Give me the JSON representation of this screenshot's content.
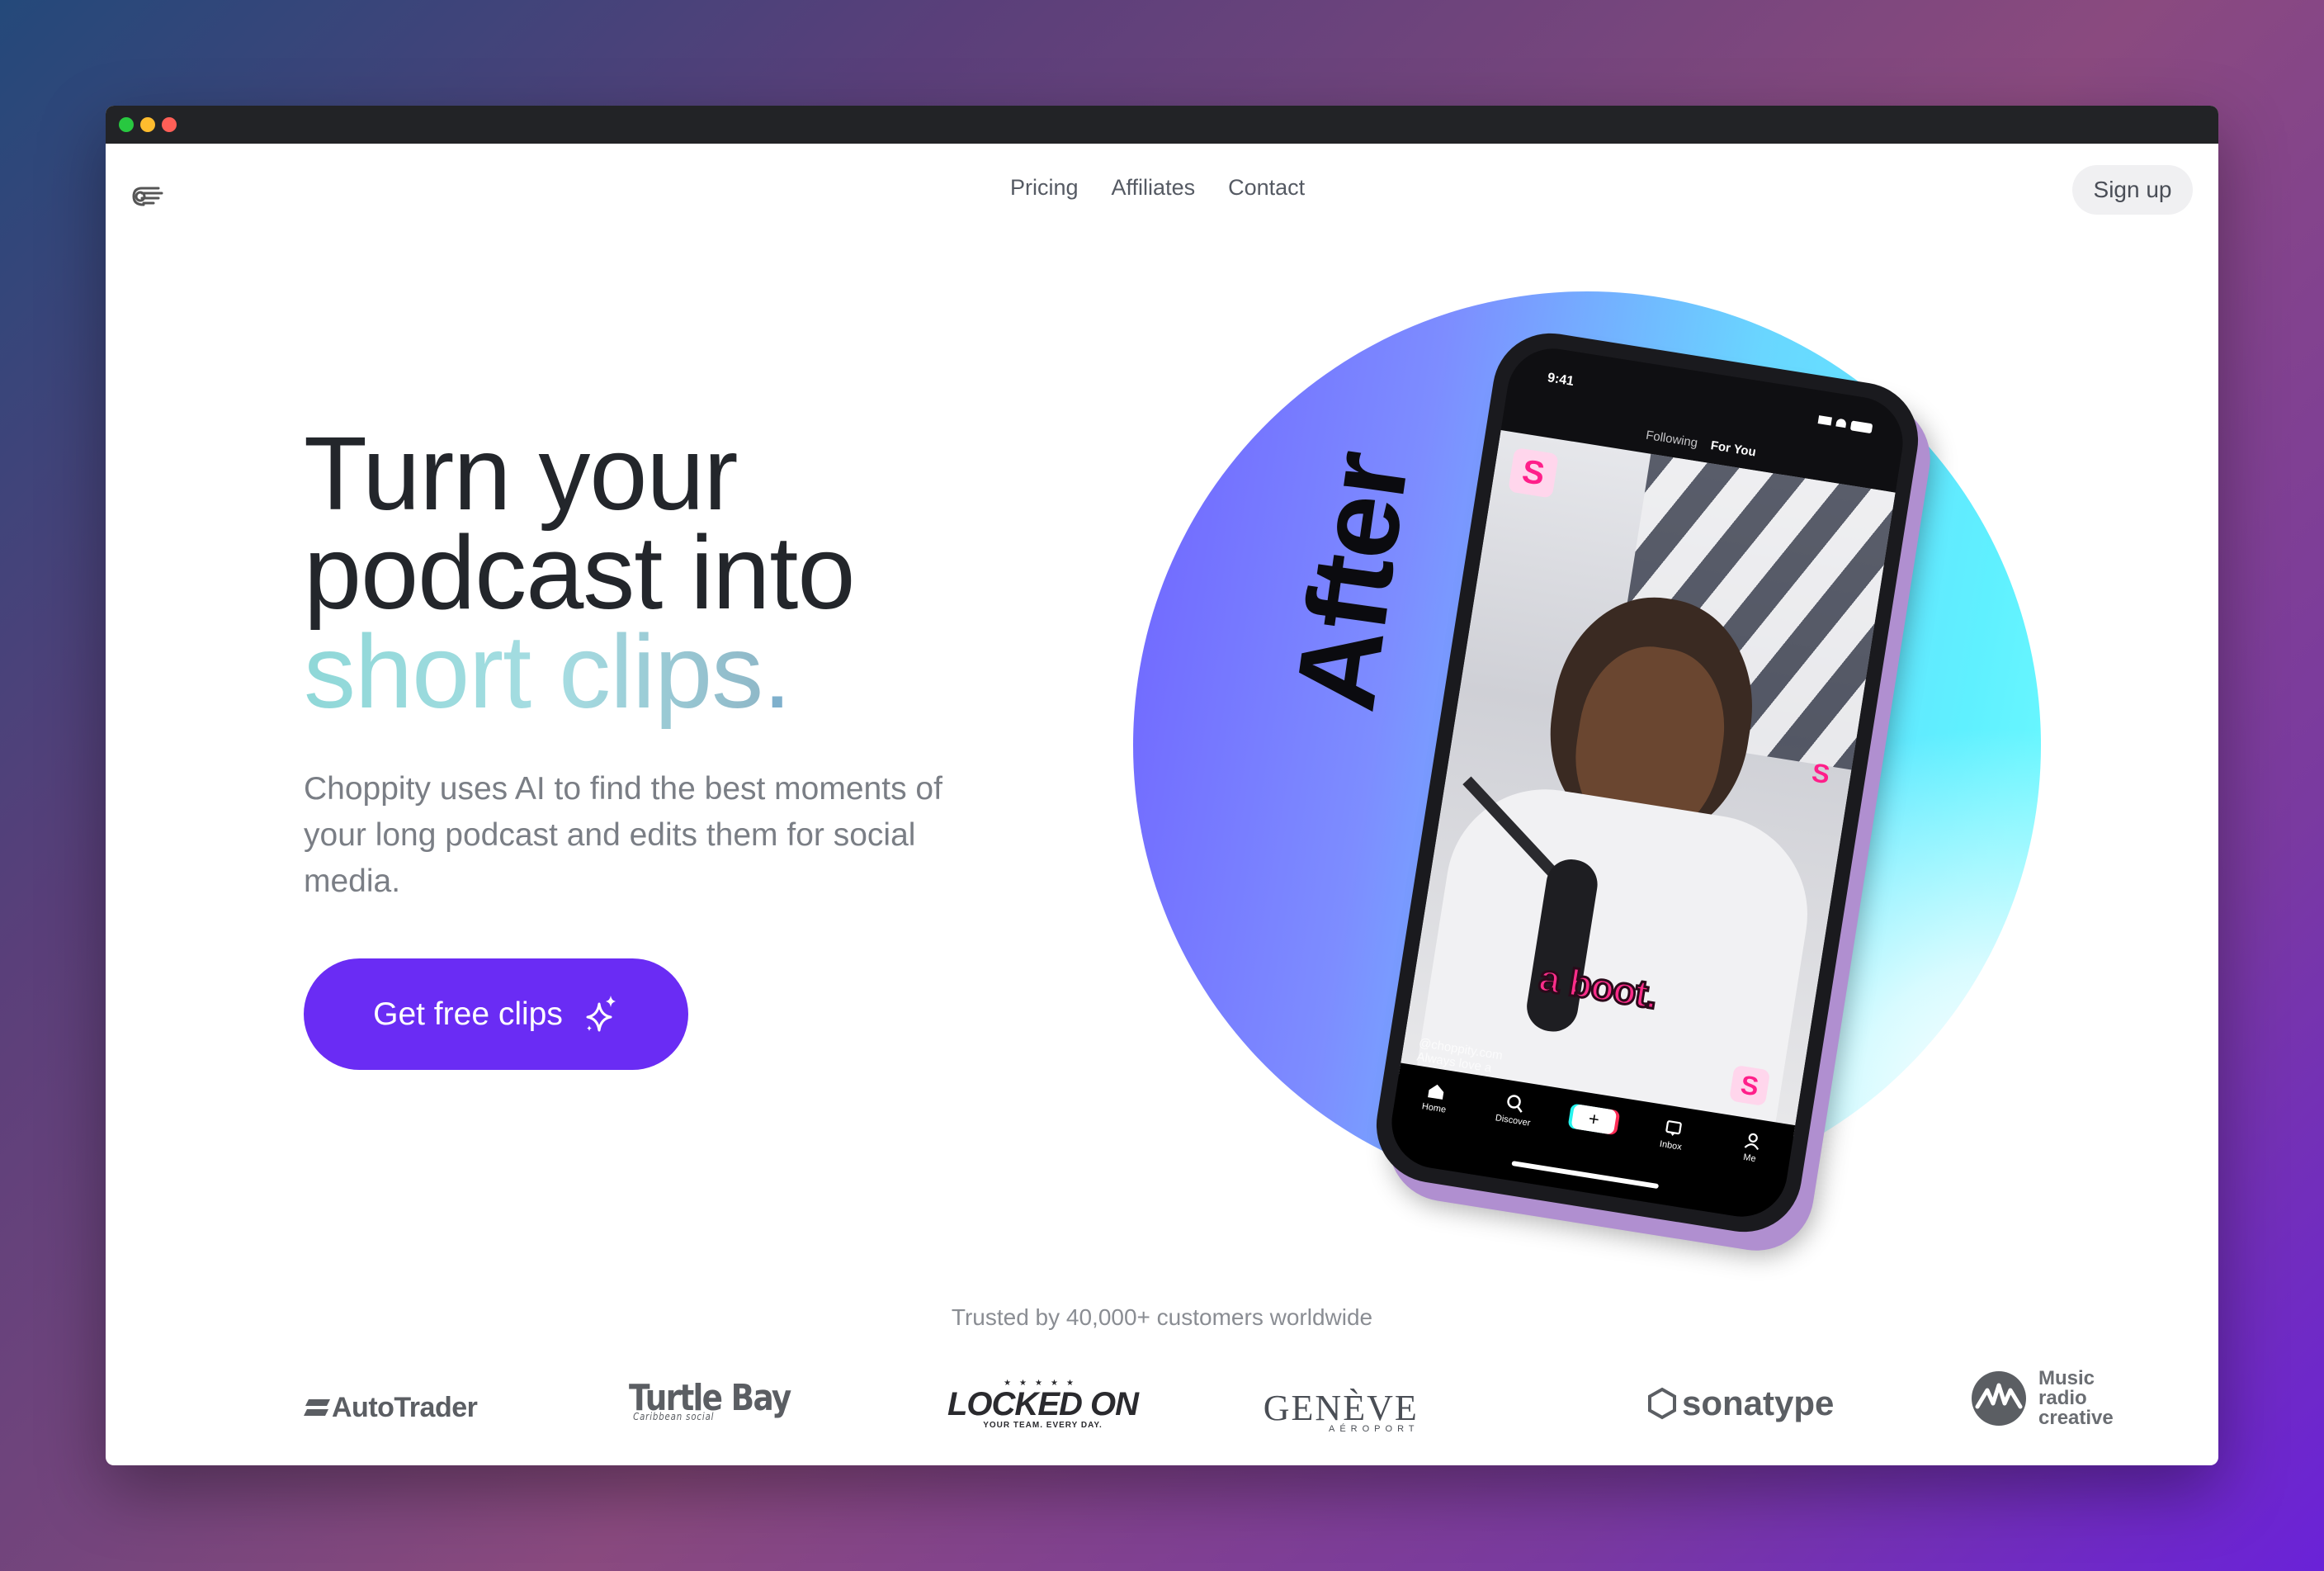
{
  "nav": {
    "links": [
      "Pricing",
      "Affiliates",
      "Contact"
    ],
    "signup_label": "Sign up"
  },
  "hero": {
    "title_line1": "Turn your",
    "title_line2": "podcast into",
    "title_accent": "short clips",
    "title_period": ".",
    "subtitle": "Choppity uses AI to find the best moments of your long podcast and edits them for social media.",
    "cta_label": "Get free clips",
    "after_label": "After"
  },
  "phone": {
    "time": "9:41",
    "tab_following": "Following",
    "tab_for_you": "For You",
    "caption": "a boot.",
    "badge_letter": "S",
    "watermark": "@choppity.com",
    "watermark_line2": "Always love a",
    "tabs": [
      "Home",
      "Discover",
      "Inbox",
      "Me"
    ],
    "plus": "+"
  },
  "trusted": {
    "text": "Trusted by 40,000+ customers worldwide",
    "logos": {
      "autotrader": "AutoTrader",
      "turtlebay": "Turtle Bay",
      "turtlebay_sub": "Caribbean social",
      "lockedon": "LOCKED ON",
      "lockedon_sub": "YOUR TEAM. EVERY DAY.",
      "geneve": "GENÈVE",
      "geneve_sub": "AÉROPORT",
      "sonatype": "sonatype",
      "music1": "Music",
      "music2": "radio",
      "music3": "creative"
    }
  },
  "colors": {
    "cta": "#6a2cf4",
    "accent_text": "#8fd8d8",
    "caption_pink": "#ff2d8a"
  }
}
